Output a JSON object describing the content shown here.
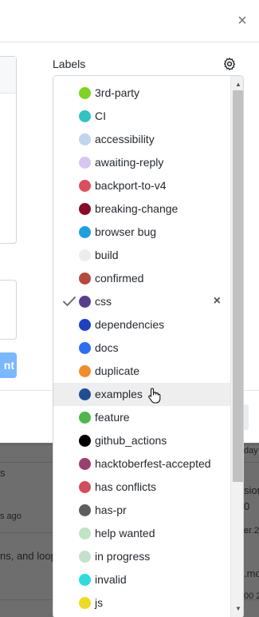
{
  "dialog": {
    "close_symbol": "×"
  },
  "left_panel": {
    "button_label_fragment": "nt"
  },
  "background_list": {
    "row1_text": "s",
    "row1_time": "s ago",
    "row1_right_top": "day",
    "row2_text": "ns, and loop",
    "row2_right_a": "sion",
    "row2_right_b": "0",
    "row2_right_c": "er 2",
    "row3_right_a": ".mo",
    "row3_right_b": "00 2"
  },
  "labels_panel": {
    "title": "Labels",
    "settings_icon": "gear-icon",
    "items": [
      {
        "name": "3rd-party",
        "color": "#7ED321",
        "selected": false
      },
      {
        "name": "CI",
        "color": "#2FC4C4",
        "selected": false
      },
      {
        "name": "accessibility",
        "color": "#C0D3F0",
        "selected": false
      },
      {
        "name": "awaiting-reply",
        "color": "#D7C6F3",
        "selected": false
      },
      {
        "name": "backport-to-v4",
        "color": "#DC4E5A",
        "selected": false
      },
      {
        "name": "breaking-change",
        "color": "#8A0A28",
        "selected": false
      },
      {
        "name": "browser bug",
        "color": "#1FA0DE",
        "selected": false
      },
      {
        "name": "build",
        "color": "#EDEDED",
        "selected": false
      },
      {
        "name": "confirmed",
        "color": "#B5493F",
        "selected": false
      },
      {
        "name": "css",
        "color": "#5A3E8A",
        "selected": true
      },
      {
        "name": "dependencies",
        "color": "#1D40C4",
        "selected": false
      },
      {
        "name": "docs",
        "color": "#2E6FF0",
        "selected": false
      },
      {
        "name": "duplicate",
        "color": "#F28C2A",
        "selected": false
      },
      {
        "name": "examples",
        "color": "#1E4E96",
        "selected": false,
        "hovered": true
      },
      {
        "name": "feature",
        "color": "#4CB84C",
        "selected": false
      },
      {
        "name": "github_actions",
        "color": "#000000",
        "selected": false
      },
      {
        "name": "hacktoberfest-accepted",
        "color": "#9A3F6E",
        "selected": false
      },
      {
        "name": "has conflicts",
        "color": "#D24E5A",
        "selected": false
      },
      {
        "name": "has-pr",
        "color": "#5E5E5E",
        "selected": false
      },
      {
        "name": "help wanted",
        "color": "#BFE5C2",
        "selected": false
      },
      {
        "name": "in progress",
        "color": "#C3E1CC",
        "selected": false
      },
      {
        "name": "invalid",
        "color": "#2CDDE0",
        "selected": false
      },
      {
        "name": "js",
        "color": "#F0DA1E",
        "selected": false
      }
    ],
    "remove_symbol": "×"
  }
}
